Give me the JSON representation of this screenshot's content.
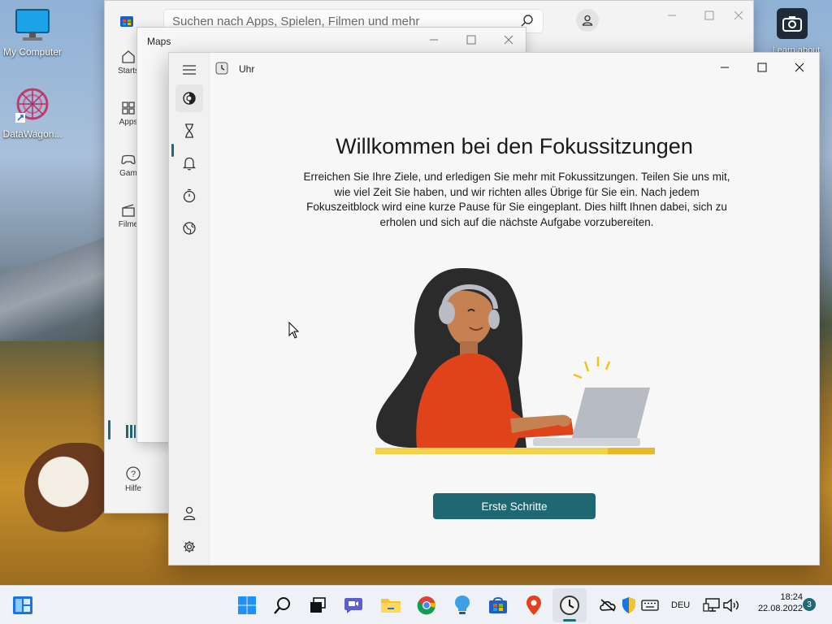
{
  "desktop": {
    "icons": [
      {
        "label": "My Computer"
      },
      {
        "label": "DataWagon..."
      }
    ],
    "top_right_label": "Learn about"
  },
  "store": {
    "search_placeholder": "Suchen nach Apps, Spielen, Filmen und mehr",
    "nav": [
      {
        "label": "Starts"
      },
      {
        "label": "Apps"
      },
      {
        "label": "Gam"
      },
      {
        "label": "Filme"
      }
    ],
    "help_label": "Hilfe"
  },
  "maps": {
    "title": "Maps"
  },
  "clock": {
    "title": "Uhr",
    "heading": "Willkommen bei den Fokussitzungen",
    "description": "Erreichen Sie Ihre Ziele, und erledigen Sie mehr mit Fokussitzungen. Teilen Sie uns mit, wie viel Zeit Sie haben, und wir richten alles Übrige für Sie ein. Nach jedem Fokuszeitblock wird eine kurze Pause für Sie eingeplant. Dies hilft Ihnen dabei, sich zu erholen und sich auf die nächste Aufgabe vorzubereiten.",
    "primary_button": "Erste Schritte",
    "accent": "#1f6773"
  },
  "taskbar": {
    "language": "DEU",
    "time": "18:24",
    "date": "22.08.2022",
    "notification_count": "3"
  }
}
